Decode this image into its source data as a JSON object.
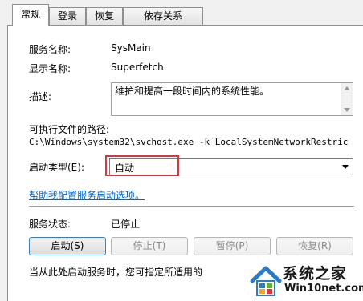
{
  "tabs": [
    {
      "label": "常规",
      "active": true
    },
    {
      "label": "登录",
      "active": false
    },
    {
      "label": "恢复",
      "active": false
    },
    {
      "label": "依存关系",
      "active": false
    }
  ],
  "service_name": {
    "label": "服务名称:",
    "value": "SysMain"
  },
  "display_name": {
    "label": "显示名称:",
    "value": "Superfetch"
  },
  "description": {
    "label": "描述:",
    "value": "维护和提高一段时间内的系统性能。"
  },
  "exe_path": {
    "label": "可执行文件的路径:",
    "value": "C:\\Windows\\system32\\svchost.exe -k LocalSystemNetworkRestric"
  },
  "startup_type": {
    "label": "启动类型(E):",
    "value": "自动"
  },
  "help_link": "帮助我配置服务启动选项。",
  "service_status": {
    "label": "服务状态:",
    "value": "已停止"
  },
  "buttons": {
    "start": "启动(S)",
    "stop": "停止(T)",
    "pause": "暂停(P)",
    "resume": "恢复(R)"
  },
  "hint_text": "当从此处启动服务时，您可指定所适用的",
  "watermark": {
    "title": "系统之家",
    "url": "Win10net.com"
  },
  "colors": {
    "highlight": "#d9363e",
    "link": "#0066cc"
  }
}
